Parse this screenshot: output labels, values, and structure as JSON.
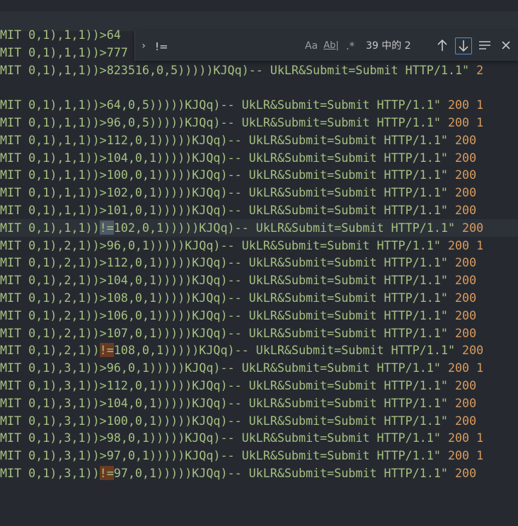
{
  "find": {
    "query": "!=",
    "match_case_label": "Aa",
    "whole_word_label": "Ab|",
    "regex_label": ".*",
    "count_text": "39 中的 2"
  },
  "lines": [
    {
      "pre": "MIT 0,1),1,1))>64",
      "match": "",
      "post": "",
      "num": ""
    },
    {
      "pre": "MIT 0,1),1,1))>777",
      "match": "",
      "post": "",
      "num": ""
    },
    {
      "pre": "MIT 0,1),1,1))>823516,0,5)))))KJQq)-- UkLR&Submit=Submit HTTP/1.1\" ",
      "match": "",
      "post": "",
      "num": "2"
    },
    {
      "pre": "",
      "match": "",
      "post": "",
      "num": ""
    },
    {
      "pre": "MIT 0,1),1,1))>64,0,5)))))KJQq)-- UkLR&Submit=Submit HTTP/1.1\" ",
      "match": "",
      "post": "",
      "num": "200 1"
    },
    {
      "pre": "MIT 0,1),1,1))>96,0,5)))))KJQq)-- UkLR&Submit=Submit HTTP/1.1\" ",
      "match": "",
      "post": "",
      "num": "200 1"
    },
    {
      "pre": "MIT 0,1),1,1))>112,0,1)))))KJQq)-- UkLR&Submit=Submit HTTP/1.1\" ",
      "match": "",
      "post": "",
      "num": "200"
    },
    {
      "pre": "MIT 0,1),1,1))>104,0,1)))))KJQq)-- UkLR&Submit=Submit HTTP/1.1\" ",
      "match": "",
      "post": "",
      "num": "200"
    },
    {
      "pre": "MIT 0,1),1,1))>100,0,1)))))KJQq)-- UkLR&Submit=Submit HTTP/1.1\" ",
      "match": "",
      "post": "",
      "num": "200"
    },
    {
      "pre": "MIT 0,1),1,1))>102,0,1)))))KJQq)-- UkLR&Submit=Submit HTTP/1.1\" ",
      "match": "",
      "post": "",
      "num": "200"
    },
    {
      "pre": "MIT 0,1),1,1))>101,0,1)))))KJQq)-- UkLR&Submit=Submit HTTP/1.1\" ",
      "match": "",
      "post": "",
      "num": "200"
    },
    {
      "pre": "MIT 0,1),1,1))",
      "match": "!=",
      "post": "102,0,1)))))KJQq)-- UkLR&Submit=Submit HTTP/1.1\" ",
      "num": "200",
      "selected": true,
      "current": true
    },
    {
      "pre": "MIT 0,1),2,1))>96,0,1)))))KJQq)-- UkLR&Submit=Submit HTTP/1.1\" ",
      "match": "",
      "post": "",
      "num": "200 1"
    },
    {
      "pre": "MIT 0,1),2,1))>112,0,1)))))KJQq)-- UkLR&Submit=Submit HTTP/1.1\" ",
      "match": "",
      "post": "",
      "num": "200"
    },
    {
      "pre": "MIT 0,1),2,1))>104,0,1)))))KJQq)-- UkLR&Submit=Submit HTTP/1.1\" ",
      "match": "",
      "post": "",
      "num": "200"
    },
    {
      "pre": "MIT 0,1),2,1))>108,0,1)))))KJQq)-- UkLR&Submit=Submit HTTP/1.1\" ",
      "match": "",
      "post": "",
      "num": "200"
    },
    {
      "pre": "MIT 0,1),2,1))>106,0,1)))))KJQq)-- UkLR&Submit=Submit HTTP/1.1\" ",
      "match": "",
      "post": "",
      "num": "200"
    },
    {
      "pre": "MIT 0,1),2,1))>107,0,1)))))KJQq)-- UkLR&Submit=Submit HTTP/1.1\" ",
      "match": "",
      "post": "",
      "num": "200"
    },
    {
      "pre": "MIT 0,1),2,1))",
      "match": "!=",
      "post": "108,0,1)))))KJQq)-- UkLR&Submit=Submit HTTP/1.1\" ",
      "num": "200"
    },
    {
      "pre": "MIT 0,1),3,1))>96,0,1)))))KJQq)-- UkLR&Submit=Submit HTTP/1.1\" ",
      "match": "",
      "post": "",
      "num": "200 1"
    },
    {
      "pre": "MIT 0,1),3,1))>112,0,1)))))KJQq)-- UkLR&Submit=Submit HTTP/1.1\" ",
      "match": "",
      "post": "",
      "num": "200"
    },
    {
      "pre": "MIT 0,1),3,1))>104,0,1)))))KJQq)-- UkLR&Submit=Submit HTTP/1.1\" ",
      "match": "",
      "post": "",
      "num": "200"
    },
    {
      "pre": "MIT 0,1),3,1))>100,0,1)))))KJQq)-- UkLR&Submit=Submit HTTP/1.1\" ",
      "match": "",
      "post": "",
      "num": "200"
    },
    {
      "pre": "MIT 0,1),3,1))>98,0,1)))))KJQq)-- UkLR&Submit=Submit HTTP/1.1\" ",
      "match": "",
      "post": "",
      "num": "200 1"
    },
    {
      "pre": "MIT 0,1),3,1))>97,0,1)))))KJQq)-- UkLR&Submit=Submit HTTP/1.1\" ",
      "match": "",
      "post": "",
      "num": "200 1"
    },
    {
      "pre": "MIT 0,1),3,1))",
      "match": "!=",
      "post": "97,0,1)))))KJQq)-- UkLR&Submit=Submit HTTP/1.1\" ",
      "num": "200"
    }
  ],
  "colors": {
    "background": "#262a30",
    "text": "#a7c080",
    "number": "#d99a5e",
    "match": "#6a3a22",
    "selected_match": "#4d5a66",
    "accent": "#4a90d9"
  },
  "icons": {
    "toggle_replace": "chevron-right-icon",
    "previous": "arrow-up-icon",
    "next": "arrow-down-icon",
    "find_in_selection": "lines-icon",
    "close": "close-icon"
  }
}
